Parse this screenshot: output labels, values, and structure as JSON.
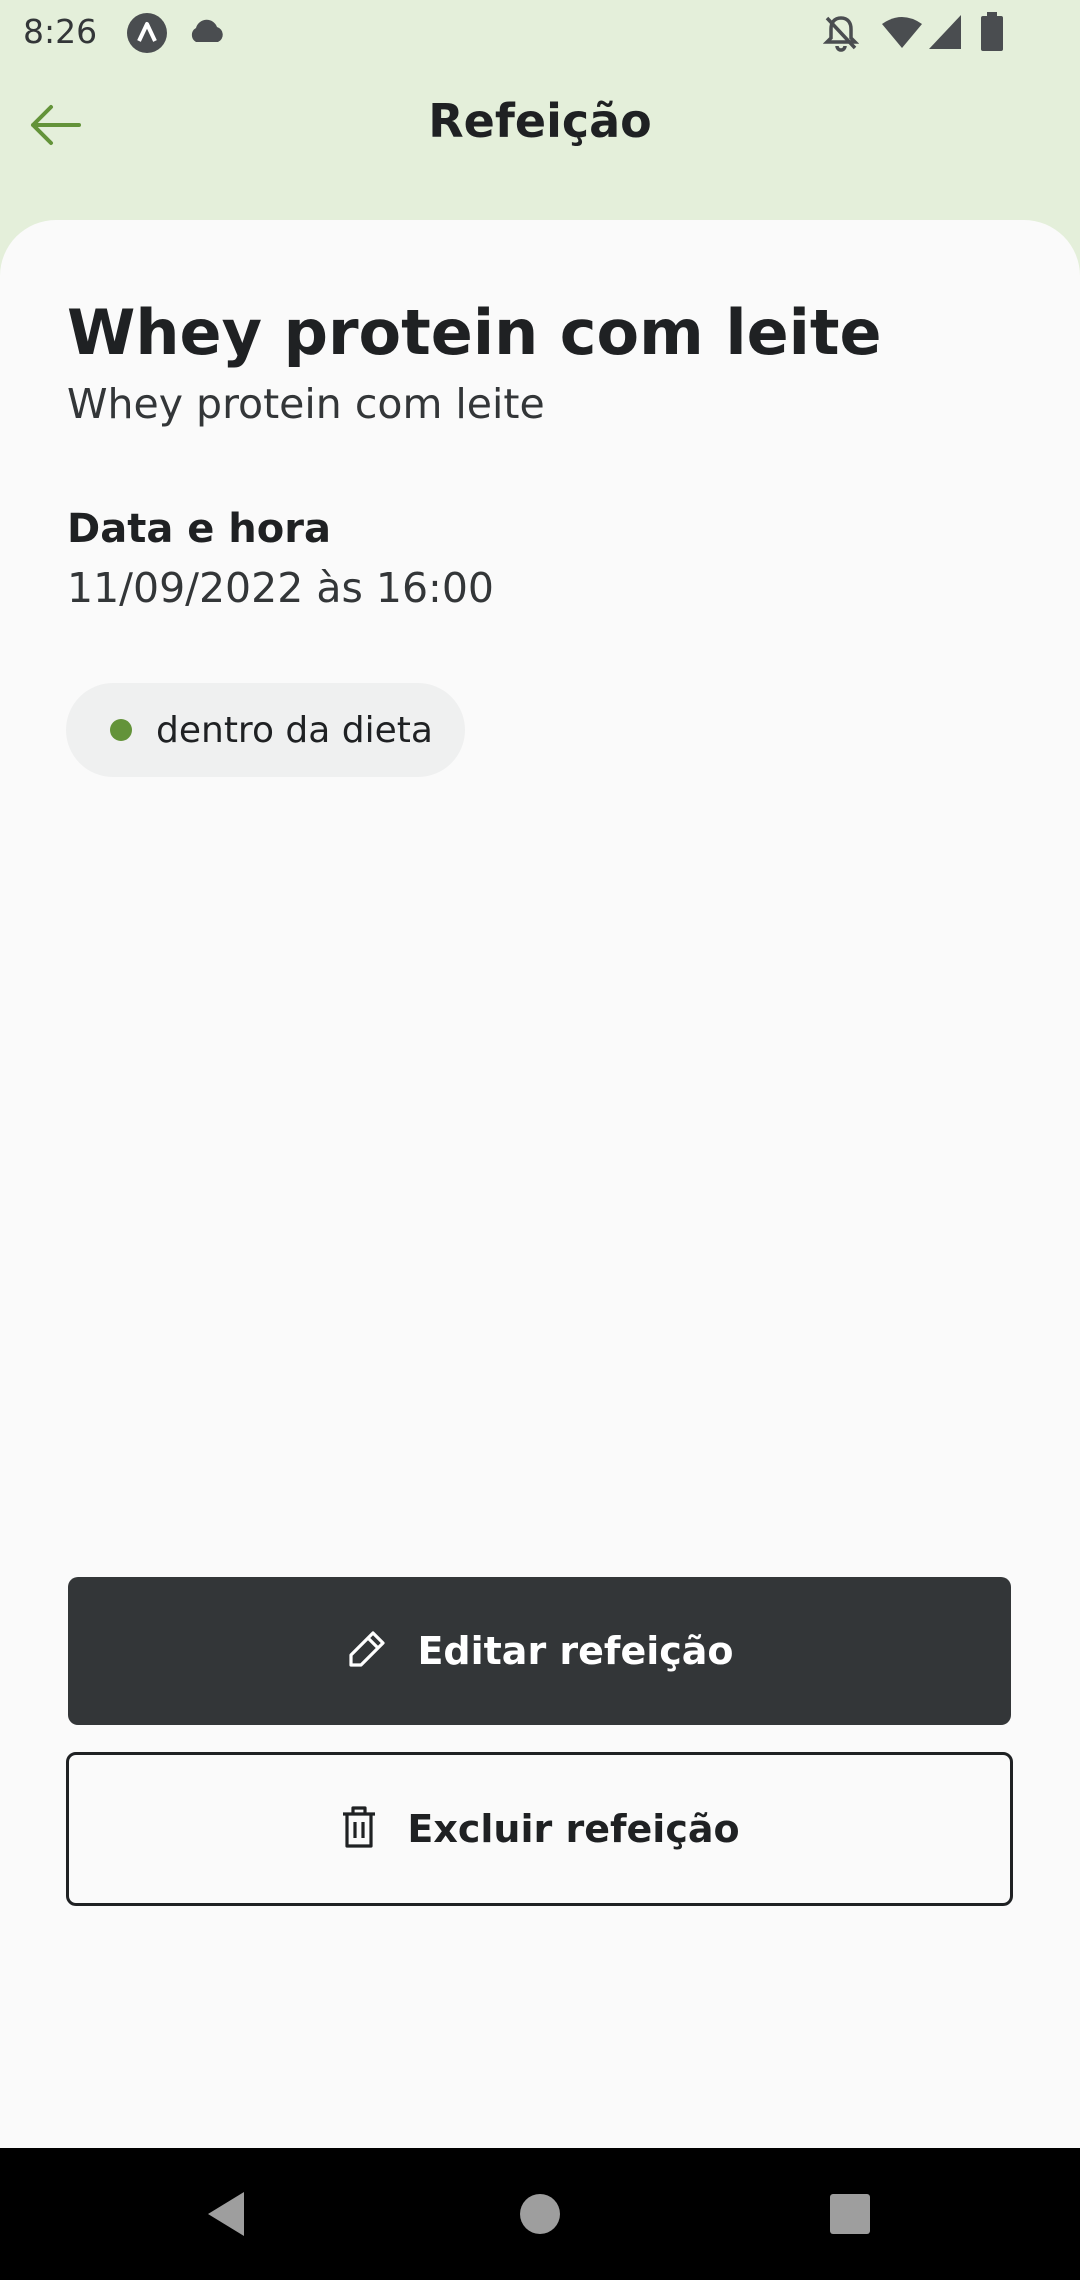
{
  "status_bar": {
    "time": "8:26",
    "icons": [
      "app-notification-icon",
      "cloud-icon",
      "bell-off-icon",
      "wifi-icon",
      "signal-icon",
      "battery-icon"
    ]
  },
  "header": {
    "title": "Refeição",
    "back_icon": "arrow-left-icon",
    "accent_color": "#639339"
  },
  "meal": {
    "name": "Whey protein com leite",
    "description": "Whey protein com leite",
    "datetime_label": "Data e hora",
    "datetime_value": "11/09/2022 às 16:00",
    "diet_status": "dentro da dieta",
    "diet_status_color": "#639339"
  },
  "actions": {
    "edit_label": "Editar refeição",
    "edit_icon": "pencil-icon",
    "delete_label": "Excluir refeição",
    "delete_icon": "trash-icon"
  },
  "nav_bar": {
    "buttons": [
      "back-triangle-icon",
      "home-circle-icon",
      "recents-square-icon"
    ]
  }
}
